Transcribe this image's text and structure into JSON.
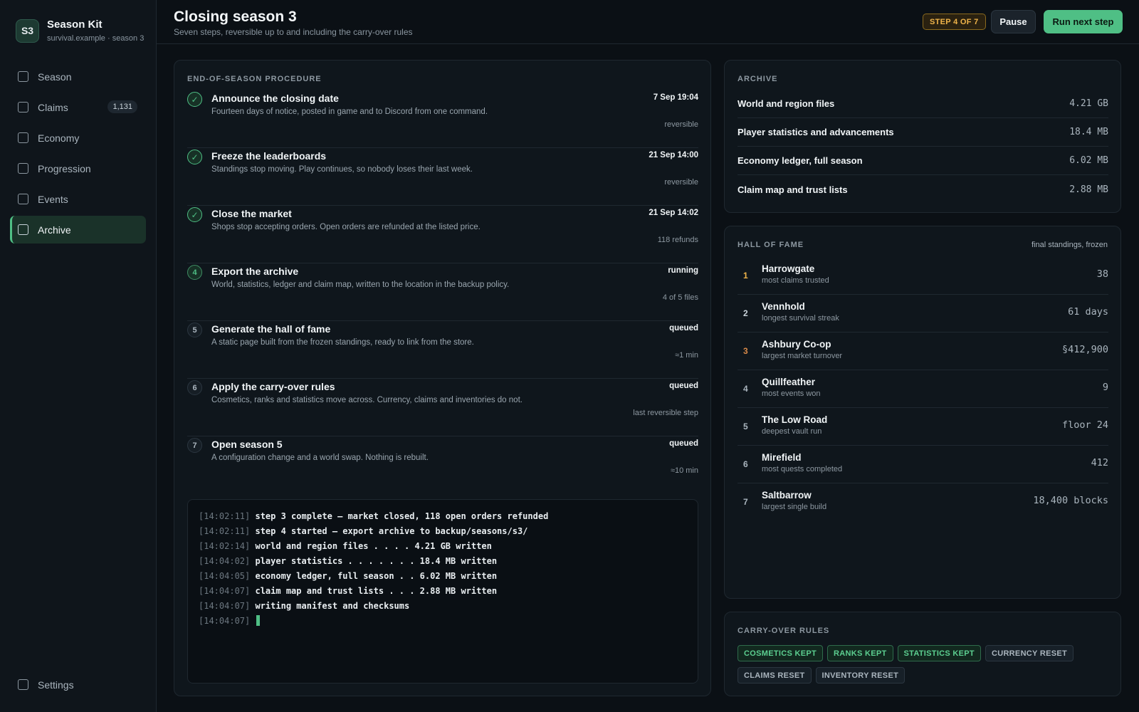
{
  "app": {
    "badge": "S3",
    "name": "Season Kit",
    "subtitle": "survival.example · season 3"
  },
  "sidebar": {
    "items": [
      {
        "label": "Season"
      },
      {
        "label": "Claims",
        "count": "1,131"
      },
      {
        "label": "Economy"
      },
      {
        "label": "Progression"
      },
      {
        "label": "Events"
      },
      {
        "label": "Archive",
        "active": true
      }
    ],
    "settings": "Settings"
  },
  "header": {
    "title": "Closing season 3",
    "subtitle": "Seven steps, reversible up to and including the carry-over rules",
    "step_badge": "STEP 4 OF 7",
    "pause": "Pause",
    "run": "Run next step"
  },
  "procedure": {
    "label": "END-OF-SEASON PROCEDURE",
    "steps": [
      {
        "marker": "✓",
        "state": "done",
        "title": "Announce the closing date",
        "desc": "Fourteen days of notice, posted in game and to Discord from one command.",
        "time": "7 Sep 19:04",
        "note": "reversible"
      },
      {
        "marker": "✓",
        "state": "done",
        "title": "Freeze the leaderboards",
        "desc": "Standings stop moving. Play continues, so nobody loses their last week.",
        "time": "21 Sep 14:00",
        "note": "reversible"
      },
      {
        "marker": "✓",
        "state": "done",
        "title": "Close the market",
        "desc": "Shops stop accepting orders. Open orders are refunded at the listed price.",
        "time": "21 Sep 14:02",
        "note": "118 refunds"
      },
      {
        "marker": "4",
        "state": "running",
        "title": "Export the archive",
        "desc": "World, statistics, ledger and claim map, written to the location in the backup policy.",
        "time": "running",
        "note": "4 of 5 files"
      },
      {
        "marker": "5",
        "state": "queued",
        "title": "Generate the hall of fame",
        "desc": "A static page built from the frozen standings, ready to link from the store.",
        "time": "queued",
        "note": "≈1 min"
      },
      {
        "marker": "6",
        "state": "queued",
        "title": "Apply the carry-over rules",
        "desc": "Cosmetics, ranks and statistics move across. Currency, claims and inventories do not.",
        "time": "queued",
        "note": "last reversible step"
      },
      {
        "marker": "7",
        "state": "queued",
        "title": "Open season 5",
        "desc": "A configuration change and a world swap. Nothing is rebuilt.",
        "time": "queued",
        "note": "≈10 min"
      }
    ]
  },
  "console": {
    "lines": [
      {
        "ts": "[14:02:11]",
        "text": "step 3 complete — market closed, 118 open orders refunded"
      },
      {
        "ts": "[14:02:11]",
        "text": "step 4 started — export archive to backup/seasons/s3/"
      },
      {
        "ts": "[14:02:14]",
        "text": "world and region files . . . . 4.21 GB written"
      },
      {
        "ts": "[14:04:02]",
        "text": "player statistics . . . . . . . 18.4 MB written"
      },
      {
        "ts": "[14:04:05]",
        "text": "economy ledger, full season . . 6.02 MB written"
      },
      {
        "ts": "[14:04:07]",
        "text": "claim map and trust lists . . . 2.88 MB written"
      },
      {
        "ts": "[14:04:07]",
        "text": "writing manifest and checksums"
      },
      {
        "ts": "[14:04:07]",
        "text": ""
      }
    ]
  },
  "archive": {
    "label": "ARCHIVE",
    "rows": [
      {
        "name": "World and region files",
        "size": "4.21 GB"
      },
      {
        "name": "Player statistics and advancements",
        "size": "18.4 MB"
      },
      {
        "name": "Economy ledger, full season",
        "size": "6.02 MB"
      },
      {
        "name": "Claim map and trust lists",
        "size": "2.88 MB"
      }
    ]
  },
  "hall_of_fame": {
    "label": "HALL OF FAME",
    "meta": "final standings, frozen",
    "rows": [
      {
        "rank": "1",
        "name": "Harrowgate",
        "desc": "most claims trusted",
        "value": "38",
        "rank_color": "#f0b44a"
      },
      {
        "rank": "2",
        "name": "Vennhold",
        "desc": "longest survival streak",
        "value": "61 days",
        "rank_color": "#c9d3da"
      },
      {
        "rank": "3",
        "name": "Ashbury Co-op",
        "desc": "largest market turnover",
        "value": "§412,900",
        "rank_color": "#d98a4a"
      },
      {
        "rank": "4",
        "name": "Quillfeather",
        "desc": "most events won",
        "value": "9",
        "rank_color": "#aab5be"
      },
      {
        "rank": "5",
        "name": "The Low Road",
        "desc": "deepest vault run",
        "value": "floor 24",
        "rank_color": "#aab5be"
      },
      {
        "rank": "6",
        "name": "Mirefield",
        "desc": "most quests completed",
        "value": "412",
        "rank_color": "#aab5be"
      },
      {
        "rank": "7",
        "name": "Saltbarrow",
        "desc": "largest single build",
        "value": "18,400 blocks",
        "rank_color": "#aab5be"
      }
    ]
  },
  "carry_over": {
    "label": "CARRY-OVER RULES",
    "chips": [
      {
        "label": "COSMETICS KEPT",
        "kind": "kept"
      },
      {
        "label": "RANKS KEPT",
        "kind": "kept"
      },
      {
        "label": "STATISTICS KEPT",
        "kind": "kept"
      },
      {
        "label": "CURRENCY RESET",
        "kind": "reset"
      },
      {
        "label": "CLAIMS RESET",
        "kind": "reset"
      },
      {
        "label": "INVENTORY RESET",
        "kind": "reset"
      }
    ]
  },
  "colors": {
    "accent": "#4fbf85",
    "warning": "#f0b44a",
    "background": "#0b1015"
  }
}
